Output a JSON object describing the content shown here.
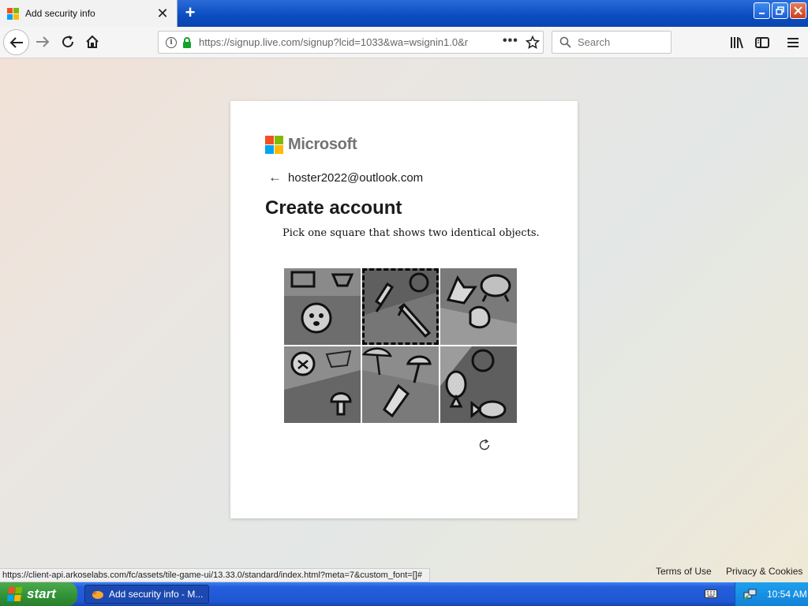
{
  "browser": {
    "tab_title": "Add security info",
    "url": "https://signup.live.com/signup?lcid=1033&wa=wsignin1.0&r",
    "search_placeholder": "Search"
  },
  "page": {
    "brand": "Microsoft",
    "email": "hoster2022@outlook.com",
    "title": "Create account",
    "instruction": "Pick one square that shows two identical objects.",
    "tiles": [
      {
        "label": "tile-1",
        "selected": false
      },
      {
        "label": "tile-2",
        "selected": true
      },
      {
        "label": "tile-3",
        "selected": false
      },
      {
        "label": "tile-4",
        "selected": false
      },
      {
        "label": "tile-5",
        "selected": false
      },
      {
        "label": "tile-6",
        "selected": false
      }
    ]
  },
  "statusbar": {
    "text": "https://client-api.arkoselabs.com/fc/assets/tile-game-ui/13.33.0/standard/index.html?meta=7&custom_font=[]#"
  },
  "footer": {
    "terms": "Terms of Use",
    "privacy": "Privacy & Cookies"
  },
  "taskbar": {
    "start_label": "start",
    "task_label": "Add security info - M...",
    "clock": "10:54 AM"
  },
  "colors": {
    "ms_red": "#f25022",
    "ms_green": "#7fba00",
    "ms_blue": "#00a4ef",
    "ms_yellow": "#ffb900",
    "titlebar_blue": "#0b4cc0",
    "taskbar_blue": "#245edb",
    "start_green": "#33953a"
  },
  "icons": [
    "back-arrow-icon",
    "forward-arrow-icon",
    "reload-icon",
    "home-icon",
    "info-icon",
    "lock-icon",
    "page-actions-icon",
    "bookmark-star-icon",
    "search-icon",
    "library-icon",
    "sidebar-icon",
    "menu-icon",
    "refresh-icon"
  ]
}
